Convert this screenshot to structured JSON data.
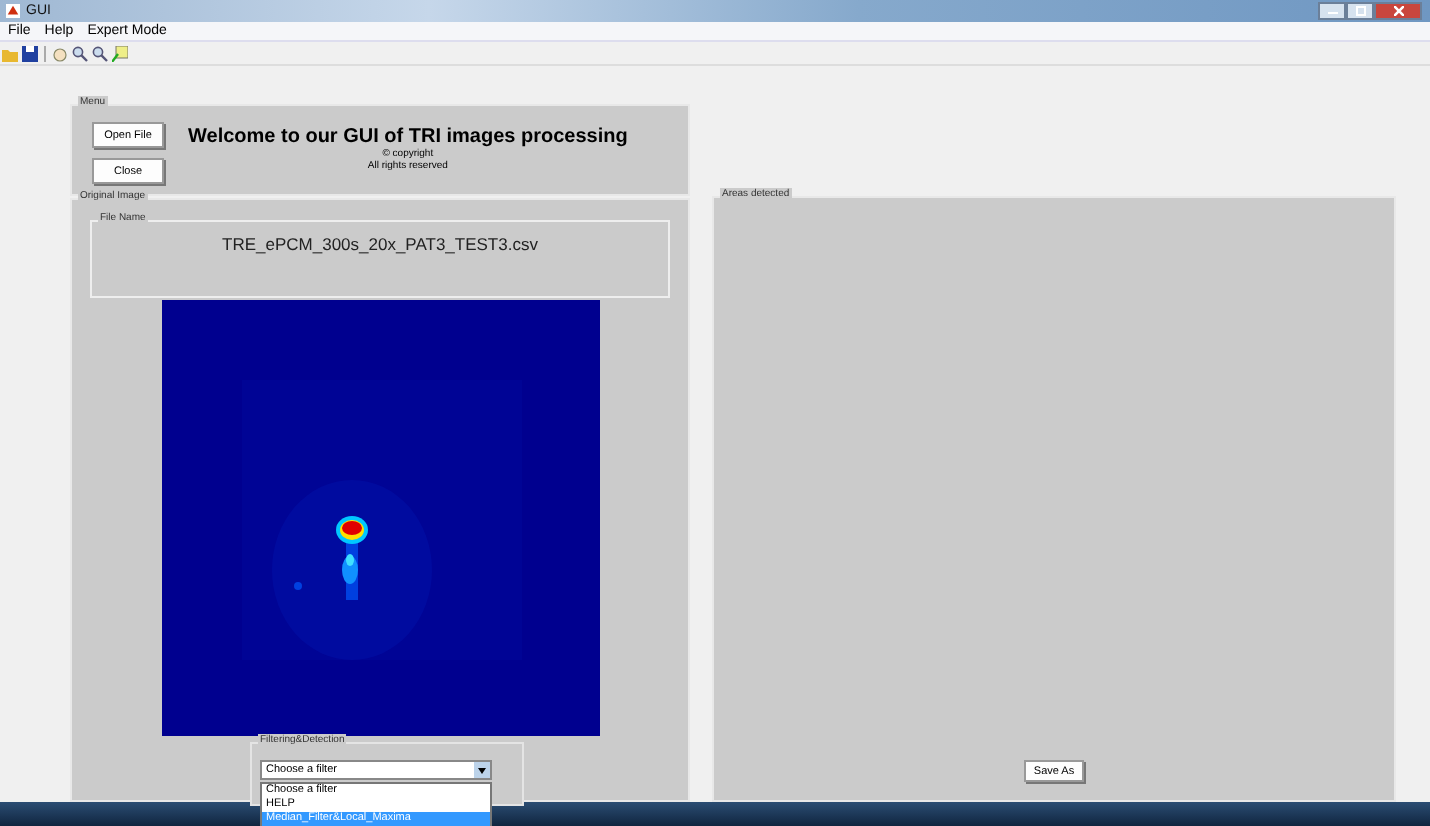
{
  "window": {
    "title": "GUI"
  },
  "menu_bar": [
    "File",
    "Help",
    "Expert Mode"
  ],
  "menu_panel": {
    "title": "Menu",
    "buttons": [
      "Open File",
      "Close"
    ],
    "heading": "Welcome to our GUI of TRI images processing",
    "copyright": "© copyright",
    "rights": "All rights reserved"
  },
  "original_image_panel": {
    "title": "Original Image",
    "file_name": {
      "title": "File Name",
      "value": "TRE_ePCM_300s_20x_PAT3_TEST3.csv"
    }
  },
  "filtering": {
    "title": "Filtering&Detection",
    "dropdown": {
      "value": "Choose a filter"
    },
    "options": [
      {
        "label": "Choose a filter",
        "selected": false
      },
      {
        "label": "HELP",
        "selected": false
      },
      {
        "label": "Median_Filter&Local_Maxima",
        "selected": true
      }
    ]
  },
  "areas_panel": {
    "title": "Areas detected",
    "button": "Save As"
  }
}
